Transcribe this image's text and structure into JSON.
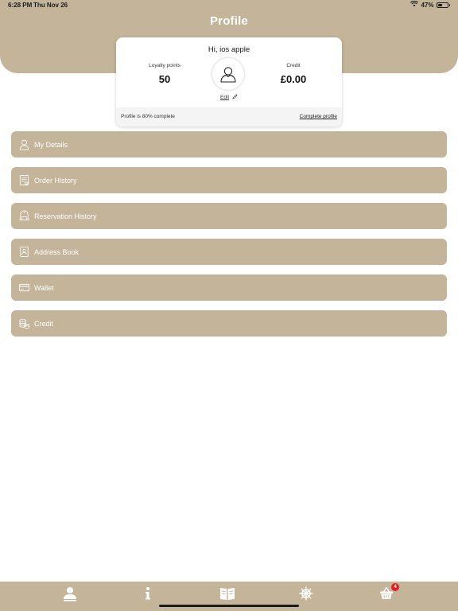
{
  "status_bar": {
    "time": "6:28 PM",
    "date": "Thu Nov 26",
    "battery": "47%",
    "battery_level": 0.47
  },
  "header": {
    "title": "Profile"
  },
  "profile_card": {
    "greeting": "Hi, ios apple",
    "loyalty_label": "Loyalty points",
    "loyalty_value": "50",
    "credit_label": "Credit",
    "credit_value": "£0.00",
    "edit_label": "Edit",
    "completion_text": "Profile is 80% complete",
    "complete_profile_label": "Complete profile"
  },
  "menu": {
    "items": [
      {
        "label": "My Details",
        "icon": "user-icon"
      },
      {
        "label": "Order History",
        "icon": "receipt-icon"
      },
      {
        "label": "Reservation History",
        "icon": "dining-icon"
      },
      {
        "label": "Address Book",
        "icon": "address-book-icon"
      },
      {
        "label": "Wallet",
        "icon": "credit-card-icon"
      },
      {
        "label": "Credit",
        "icon": "coins-icon"
      }
    ]
  },
  "tab_bar": {
    "tabs": [
      {
        "icon": "profile-icon",
        "active": true
      },
      {
        "icon": "info-icon",
        "active": false
      },
      {
        "icon": "menu-book-icon",
        "active": false
      },
      {
        "icon": "ship-wheel-icon",
        "active": false
      },
      {
        "icon": "basket-icon",
        "active": false
      }
    ],
    "basket_badge": "4"
  },
  "colors": {
    "accent": "#c3b49a",
    "badge": "#e02020"
  }
}
